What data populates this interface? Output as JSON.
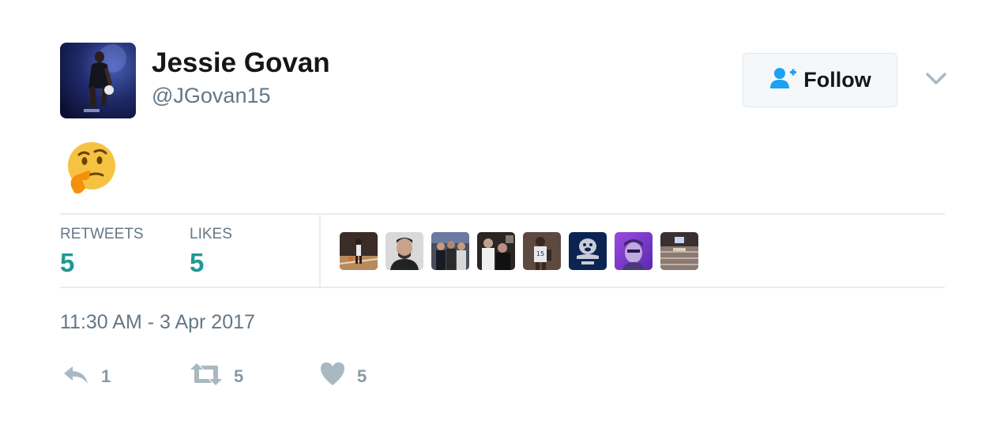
{
  "user": {
    "display_name": "Jessie Govan",
    "handle": "@JGovan15"
  },
  "follow_button": {
    "label": "Follow"
  },
  "tweet": {
    "emoji": "thinking-face"
  },
  "stats": {
    "retweets_label": "RETWEETS",
    "retweets_value": "5",
    "likes_label": "LIKES",
    "likes_value": "5"
  },
  "likers": [
    {
      "icon": "basketball-court-photo"
    },
    {
      "icon": "man-portrait-photo"
    },
    {
      "icon": "group-photo"
    },
    {
      "icon": "crowd-photo"
    },
    {
      "icon": "basketball-player-photo"
    },
    {
      "icon": "georgetown-bulldog-logo"
    },
    {
      "icon": "purple-selfie-photo"
    },
    {
      "icon": "arena-photo"
    }
  ],
  "timestamp": "11:30 AM - 3 Apr 2017",
  "actions": {
    "reply_count": "1",
    "retweet_count": "5",
    "like_count": "5"
  },
  "colors": {
    "accent": "#1da1f2",
    "stat_value": "#1c9a93",
    "muted": "#657786",
    "icon": "#aab8c2"
  }
}
